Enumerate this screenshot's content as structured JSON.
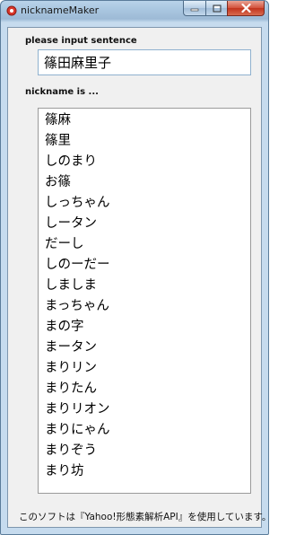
{
  "window": {
    "title": "nicknameMaker",
    "icon": "app-icon"
  },
  "form": {
    "sentence_label": "please input sentence",
    "sentence_value": "篠田麻里子",
    "nickname_label": "nickname is ..."
  },
  "nicknames": [
    "篠麻",
    "篠里",
    "しのまり",
    "お篠",
    "しっちゃん",
    "しータン",
    "だーし",
    "しのーだー",
    "しましま",
    "まっちゃん",
    "まの字",
    "まータン",
    "まりリン",
    "まりたん",
    "まりリオン",
    "まりにゃん",
    "まりぞう",
    "まり坊"
  ],
  "footer": {
    "text": "このソフトは『Yahoo!形態素解析API』を使用しています。"
  },
  "colors": {
    "titlebar": "#a9c6e0",
    "client": "#f0f0f0",
    "close_button": "#c1341d"
  }
}
